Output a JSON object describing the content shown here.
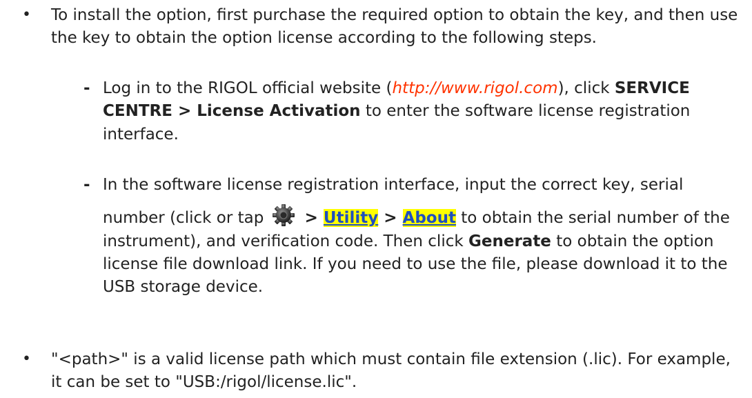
{
  "bullets": [
    {
      "symbol": "•",
      "text": "To install the option, first purchase the required option to obtain the key, and then use the key to obtain the option license according to the following steps."
    },
    {
      "symbol": "•",
      "text": "\"<path>\" is a valid license path which must contain file extension (.lic). For example, it can be set to \"USB:/rigol/license.lic\"."
    }
  ],
  "steps": [
    {
      "symbol": "-",
      "part1": "Log in to the RIGOL official website (",
      "link": "http://www.rigol.com",
      "part2": "), click ",
      "bold1": "SERVICE CENTRE > License Activation",
      "part3": " to enter the software license registration interface."
    },
    {
      "symbol": "-",
      "line1": "In the software license registration interface, input the correct key, serial",
      "part1": "number (click or tap ",
      "icon": "settings-gear-icon",
      "sep1": " > ",
      "menu1": "Utility",
      "sep2": " > ",
      "menu2": "About",
      "part2": " to obtain the serial number of the instrument), and verification code. Then click ",
      "bold1": "Generate",
      "part3": " to obtain the option license file download link. If you need to use the file, please download it to the USB storage device."
    }
  ]
}
